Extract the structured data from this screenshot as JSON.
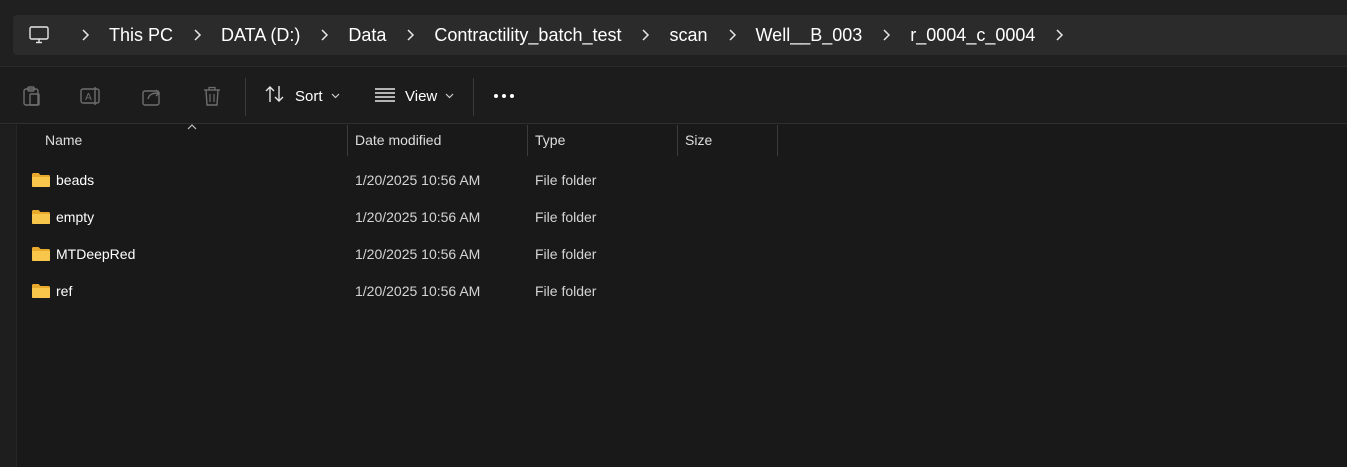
{
  "address_bar": {
    "root_icon": "computer-monitor-icon",
    "crumbs": [
      "This PC",
      "DATA (D:)",
      "Data",
      "Contractility_batch_test",
      "scan",
      "Well__B_003",
      "r_0004_c_0004"
    ],
    "separator_icon": "chevron-right-icon"
  },
  "command_bar": {
    "icons": [
      "paste-icon",
      "rename-icon",
      "share-icon",
      "delete-icon"
    ],
    "sort_label": "Sort",
    "view_label": "View",
    "more_icon": "more-options-icon"
  },
  "columns": {
    "name": "Name",
    "date_modified": "Date modified",
    "type": "Type",
    "size": "Size"
  },
  "files": [
    {
      "name": "beads",
      "date_modified": "1/20/2025 10:56 AM",
      "type": "File folder",
      "size": ""
    },
    {
      "name": "empty",
      "date_modified": "1/20/2025 10:56 AM",
      "type": "File folder",
      "size": ""
    },
    {
      "name": "MTDeepRed",
      "date_modified": "1/20/2025 10:56 AM",
      "type": "File folder",
      "size": ""
    },
    {
      "name": "ref",
      "date_modified": "1/20/2025 10:56 AM",
      "type": "File folder",
      "size": ""
    }
  ],
  "colors": {
    "background": "#191919",
    "address_bar": "#2b2b2b",
    "folder": "#f7c64a",
    "text": "#ffffff"
  }
}
